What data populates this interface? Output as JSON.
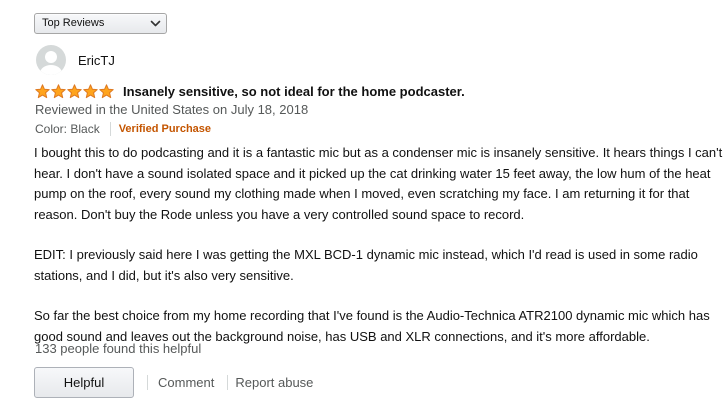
{
  "sort": {
    "selected": "Top Reviews"
  },
  "review": {
    "reviewer_name": "EricTJ",
    "rating": 5,
    "rating_max": 5,
    "title": "Insanely sensitive, so not ideal for the home podcaster.",
    "reviewed_line": "Reviewed in the United States on July 18, 2018",
    "variant": "Color: Black",
    "verified_label": "Verified Purchase",
    "body": [
      "I bought this to do podcasting and it is a fantastic mic but as a condenser mic is insanely sensitive. It hears things I can't hear. I don't have a sound isolated space and it picked up the cat drinking water 15 feet away, the low hum of the heat pump on the roof, every sound my clothing made when I moved, even scratching my face. I am returning it for that reason. Don't buy the Rode unless you have a very controlled sound space to record.",
      "EDIT: I previously said here I was getting the MXL BCD-1 dynamic mic instead, which I'd read is used in some radio stations, and I did, but it's also very sensitive.",
      "So far the best choice from my home recording that I've found is the Audio-Technica ATR2100 dynamic mic which has good sound and leaves out the background noise, has USB and XLR connections, and it's more affordable."
    ],
    "helpful_count_text": "133 people found this helpful"
  },
  "actions": {
    "helpful_label": "Helpful",
    "comment_label": "Comment",
    "report_label": "Report abuse"
  },
  "colors": {
    "star": "#ffa41c",
    "star_outline": "#de7921",
    "verified": "#c45500",
    "muted_text": "#565959"
  },
  "icons": {
    "sort_chevron": "chevron-down-icon",
    "avatar": "default-avatar-icon",
    "star": "star-icon"
  }
}
